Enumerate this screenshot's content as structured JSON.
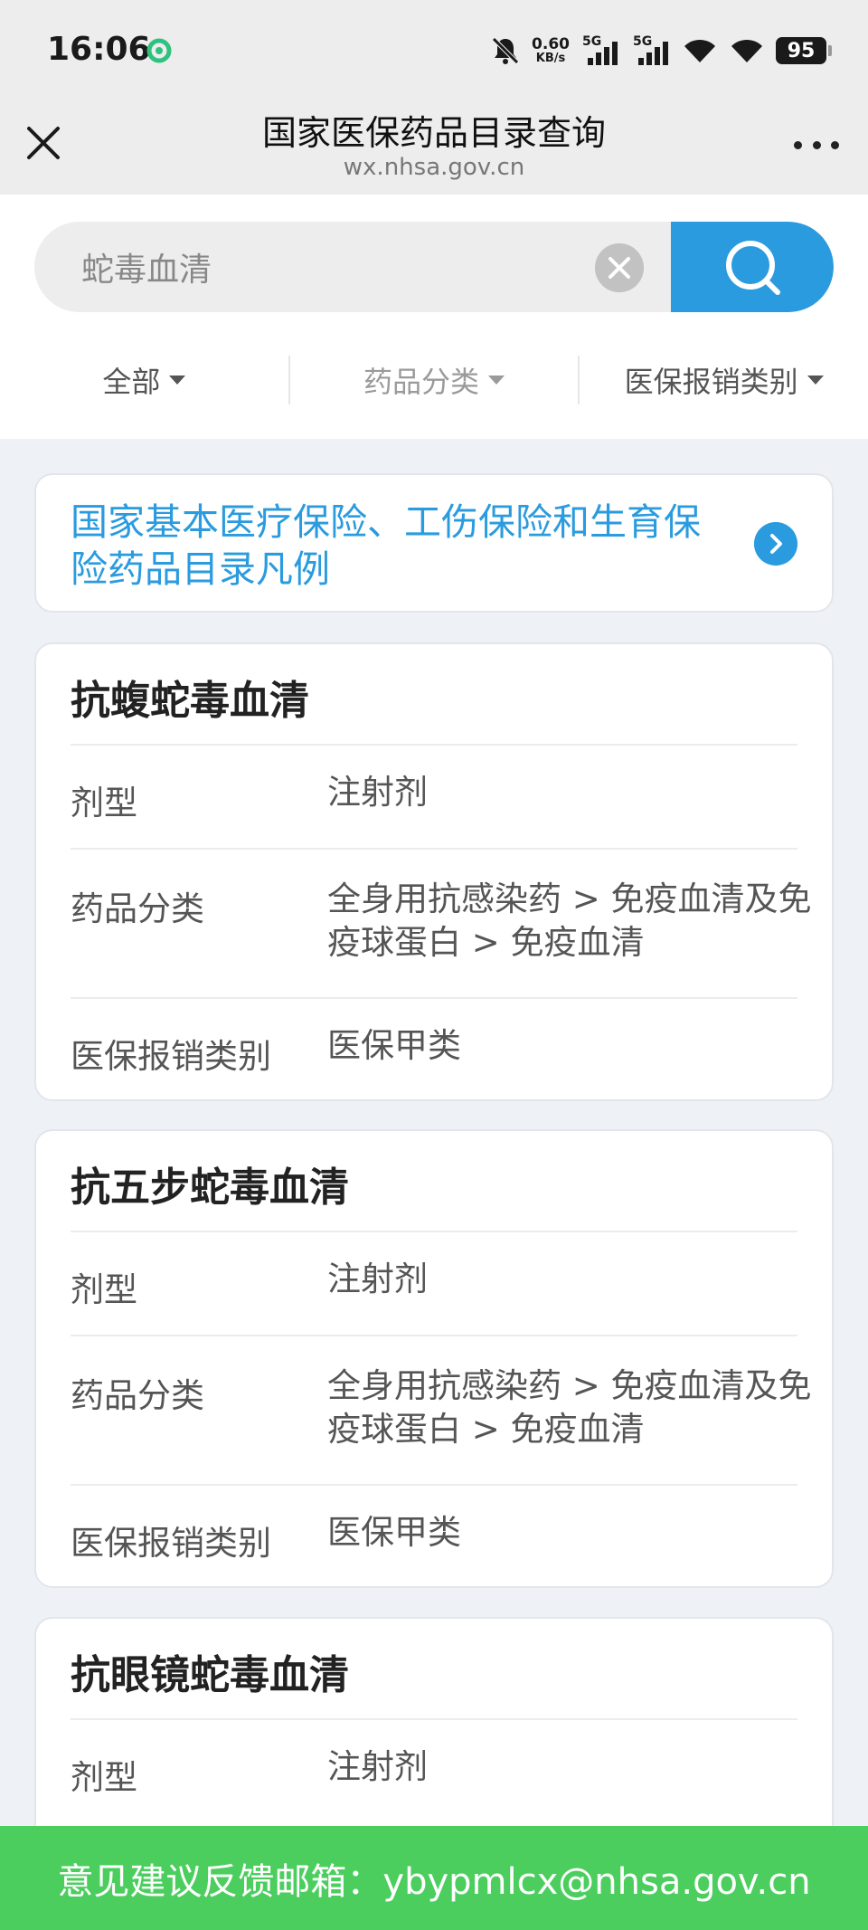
{
  "status_bar": {
    "time": "16:06",
    "speed_value": "0.60",
    "speed_unit": "KB/s",
    "signal_1": "5G",
    "signal_2": "5G",
    "battery": "95"
  },
  "nav": {
    "title": "国家医保药品目录查询",
    "subtitle": "wx.nhsa.gov.cn"
  },
  "search": {
    "value": "蛇毒血清",
    "accent_color": "#2a9bde"
  },
  "filters": [
    {
      "label": "全部"
    },
    {
      "label": "药品分类"
    },
    {
      "label": "医保报销类别"
    }
  ],
  "notice": {
    "text": "国家基本医疗保险、工伤保险和生育保险药品目录凡例"
  },
  "cards": [
    {
      "title": "抗蝮蛇毒血清",
      "rows": [
        {
          "label": "剂型",
          "value": "注射剂"
        },
        {
          "label": "药品分类",
          "value": "全身用抗感染药 > 免疫血清及免疫球蛋白 > 免疫血清"
        },
        {
          "label": "医保报销类别",
          "value": "医保甲类"
        }
      ]
    },
    {
      "title": "抗五步蛇毒血清",
      "rows": [
        {
          "label": "剂型",
          "value": "注射剂"
        },
        {
          "label": "药品分类",
          "value": "全身用抗感染药 > 免疫血清及免疫球蛋白 > 免疫血清"
        },
        {
          "label": "医保报销类别",
          "value": "医保甲类"
        }
      ]
    },
    {
      "title": "抗眼镜蛇毒血清",
      "rows": [
        {
          "label": "剂型",
          "value": "注射剂"
        }
      ]
    }
  ],
  "footer": {
    "text": "意见建议反馈邮箱：ybypmlcx@nhsa.gov.cn",
    "color": "#4cce5f"
  }
}
